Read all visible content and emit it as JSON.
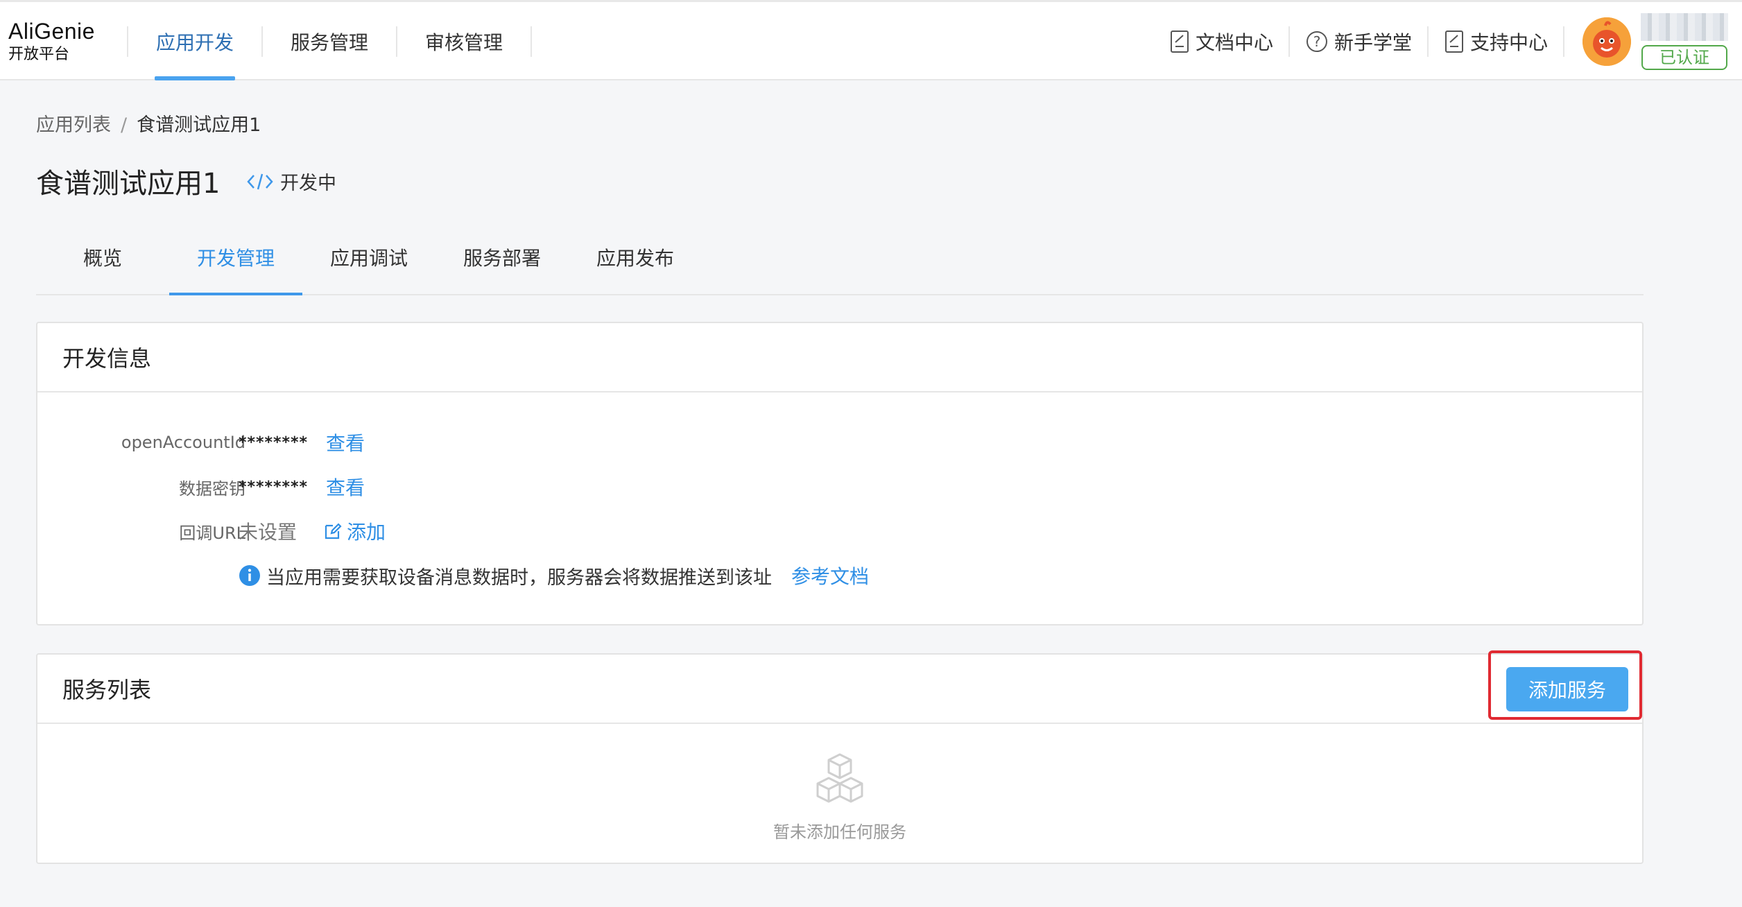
{
  "header": {
    "logo_title": "AliGenie",
    "logo_subtitle": "开放平台",
    "nav": [
      {
        "label": "应用开发",
        "active": true
      },
      {
        "label": "服务管理",
        "active": false
      },
      {
        "label": "审核管理",
        "active": false
      }
    ],
    "right_links": [
      {
        "label": "文档中心",
        "icon": "document-icon"
      },
      {
        "label": "新手学堂",
        "icon": "question-circle-icon"
      },
      {
        "label": "支持中心",
        "icon": "edit-document-icon"
      }
    ],
    "user": {
      "badge": "已认证",
      "avatar": "mascot-avatar"
    }
  },
  "breadcrumb": {
    "parent": "应用列表",
    "separator": "/",
    "current": "食谱测试应用1"
  },
  "page": {
    "title": "食谱测试应用1",
    "status": "开发中",
    "status_icon": "code-icon"
  },
  "tabs": [
    {
      "label": "概览",
      "active": false
    },
    {
      "label": "开发管理",
      "active": true
    },
    {
      "label": "应用调试",
      "active": false
    },
    {
      "label": "服务部署",
      "active": false
    },
    {
      "label": "应用发布",
      "active": false
    }
  ],
  "dev_info": {
    "title": "开发信息",
    "open_account": {
      "label": "openAccountId",
      "value": "********",
      "action": "查看"
    },
    "data_key": {
      "label": "数据密钥",
      "value": "********",
      "action": "查看"
    },
    "callback": {
      "label": "回调URL",
      "value": "未设置",
      "action": "添加"
    },
    "tip": {
      "text": "当应用需要获取设备消息数据时，服务器会将数据推送到该址",
      "link": "参考文档"
    }
  },
  "service_list": {
    "title": "服务列表",
    "add_button": "添加服务",
    "empty_text": "暂未添加任何服务",
    "empty_icon": "cubes-icon"
  },
  "colors": {
    "accent": "#2f8fe5",
    "button": "#4aa8f0",
    "highlight": "#e02a32",
    "verified": "#52a84a"
  }
}
